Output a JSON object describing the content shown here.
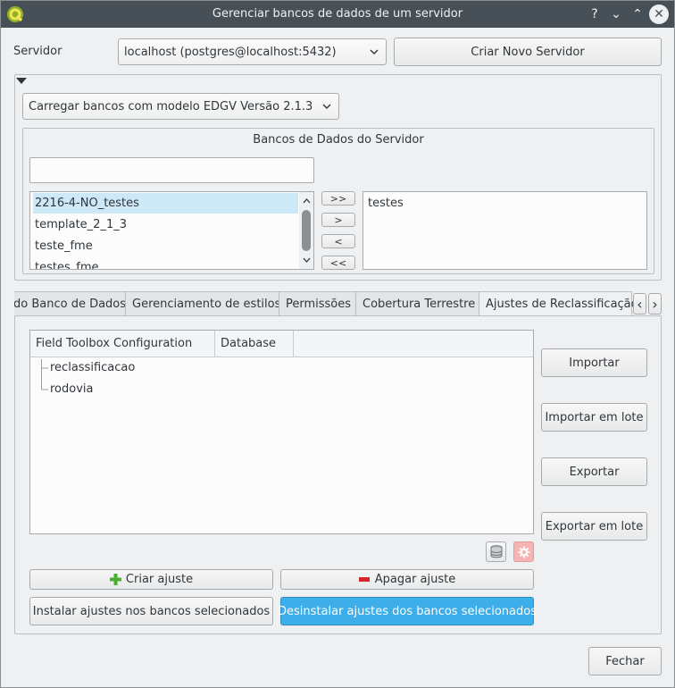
{
  "window": {
    "title": "Gerenciar bancos de dados de um servidor",
    "help": "?",
    "minimize": "⌄",
    "maximize": "⌃",
    "close": "✕"
  },
  "server": {
    "label": "Servidor",
    "selected": "localhost (postgres@localhost:5432)",
    "new_server_button": "Criar Novo Servidor"
  },
  "loader": {
    "selected": "Carregar bancos com modelo EDGV Versão 2.1.3"
  },
  "databases": {
    "title": "Bancos de Dados do Servidor",
    "filter_value": "",
    "available": [
      "2216-4-NO_testes",
      "template_2_1_3",
      "teste_fme",
      "testes_fme"
    ],
    "selected_list": [
      "testes"
    ],
    "move_all_right": ">>",
    "move_right": ">",
    "move_left": "<",
    "move_all_left": "<<"
  },
  "tabs": [
    {
      "label": "do Banco de Dados",
      "active": false
    },
    {
      "label": "Gerenciamento de estilos",
      "active": false
    },
    {
      "label": "Permissões",
      "active": false
    },
    {
      "label": "Cobertura Terrestre",
      "active": false
    },
    {
      "label": "Ajustes de Reclassificação",
      "active": true
    }
  ],
  "tab_nav": {
    "prev": "‹",
    "next": "›"
  },
  "tree": {
    "columns": [
      "Field Toolbox Configuration",
      "Database"
    ],
    "items": [
      "reclassificacao",
      "rodovia"
    ]
  },
  "side_buttons": {
    "import": "Importar",
    "import_batch": "Importar em lote",
    "export": "Exportar",
    "export_batch": "Exportar em lote"
  },
  "actions": {
    "create": "Criar ajuste",
    "delete": "Apagar ajuste",
    "install": "Instalar ajustes nos bancos selecionados",
    "uninstall": "Desinstalar ajustes dos bancos selecionados"
  },
  "footer": {
    "close": "Fechar"
  },
  "colors": {
    "titlebar": "#475057",
    "accent": "#3daee9",
    "selection": "#cde8f6",
    "create_icon": "#4caf2f",
    "delete_icon": "#d9262c"
  }
}
